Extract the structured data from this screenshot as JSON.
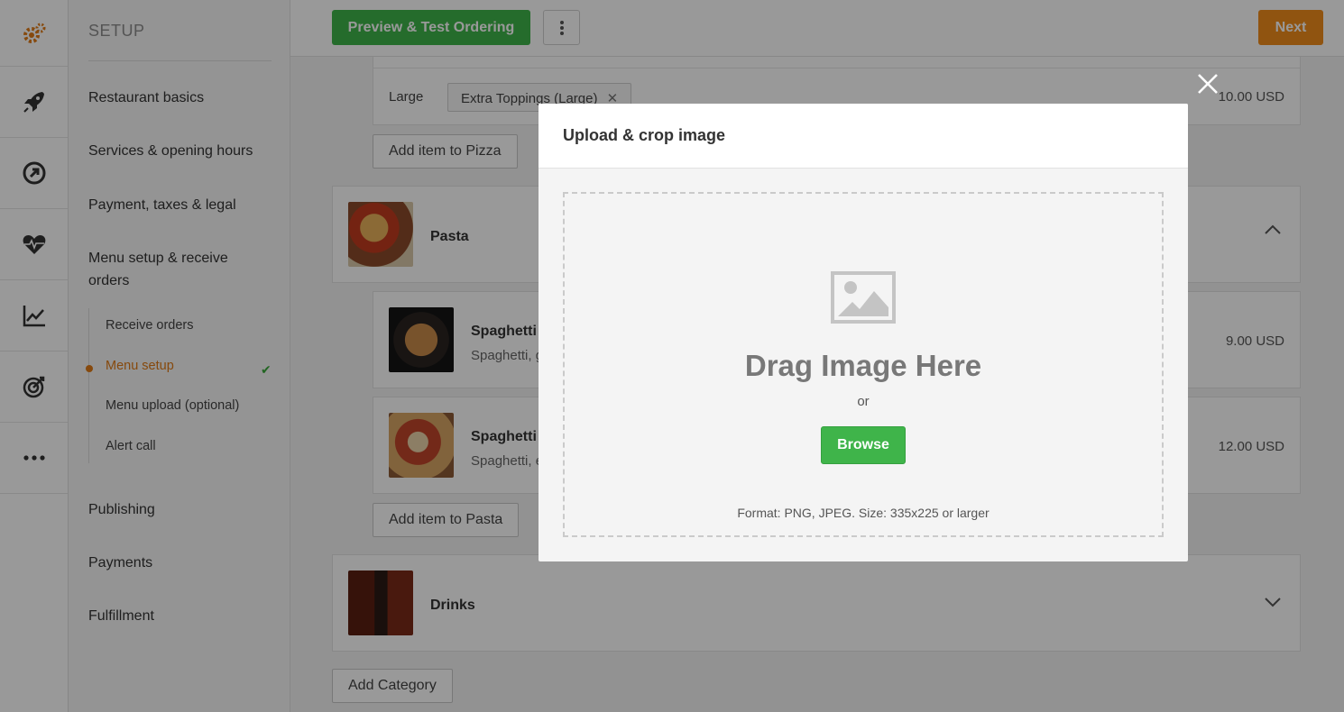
{
  "sidebar": {
    "title": "SETUP",
    "items": [
      {
        "label": "Restaurant basics"
      },
      {
        "label": "Services & opening hours"
      },
      {
        "label": "Payment, taxes & legal"
      },
      {
        "label": "Menu setup & receive orders"
      },
      {
        "label": "Publishing"
      },
      {
        "label": "Payments"
      },
      {
        "label": "Fulfillment"
      }
    ],
    "subitems": [
      {
        "label": "Receive orders"
      },
      {
        "label": "Menu setup",
        "active": true
      },
      {
        "label": "Menu upload (optional)"
      },
      {
        "label": "Alert call"
      }
    ]
  },
  "rail": {
    "icons": [
      "setup-gear-icon",
      "rocket-icon",
      "arrow-circle-icon",
      "heart-pulse-icon",
      "line-chart-icon",
      "target-icon",
      "more-icon"
    ]
  },
  "topbar": {
    "preview_label": "Preview & Test Ordering",
    "next_label": "Next"
  },
  "menu": {
    "large_label": "Large",
    "large_chip": "Extra Toppings (Large)",
    "large_price": "10.00 USD",
    "add_to_pizza": "Add item to Pizza",
    "pasta": {
      "title": "Pasta",
      "items": [
        {
          "title": "Spaghetti",
          "desc": "Spaghetti, g",
          "price": "9.00 USD"
        },
        {
          "title": "Spaghetti",
          "desc": "Spaghetti, e",
          "price": "12.00 USD"
        }
      ],
      "add_label": "Add item to Pasta"
    },
    "drinks": {
      "title": "Drinks"
    },
    "add_category": "Add Category"
  },
  "modal": {
    "title": "Upload & crop image",
    "drag_text": "Drag Image Here",
    "or_text": "or",
    "browse_label": "Browse",
    "format_text": "Format: PNG, JPEG. Size: 335x225 or larger"
  },
  "colors": {
    "accent_orange": "#f08c1c",
    "active_orange": "#e07b16",
    "green": "#3fb44a"
  }
}
